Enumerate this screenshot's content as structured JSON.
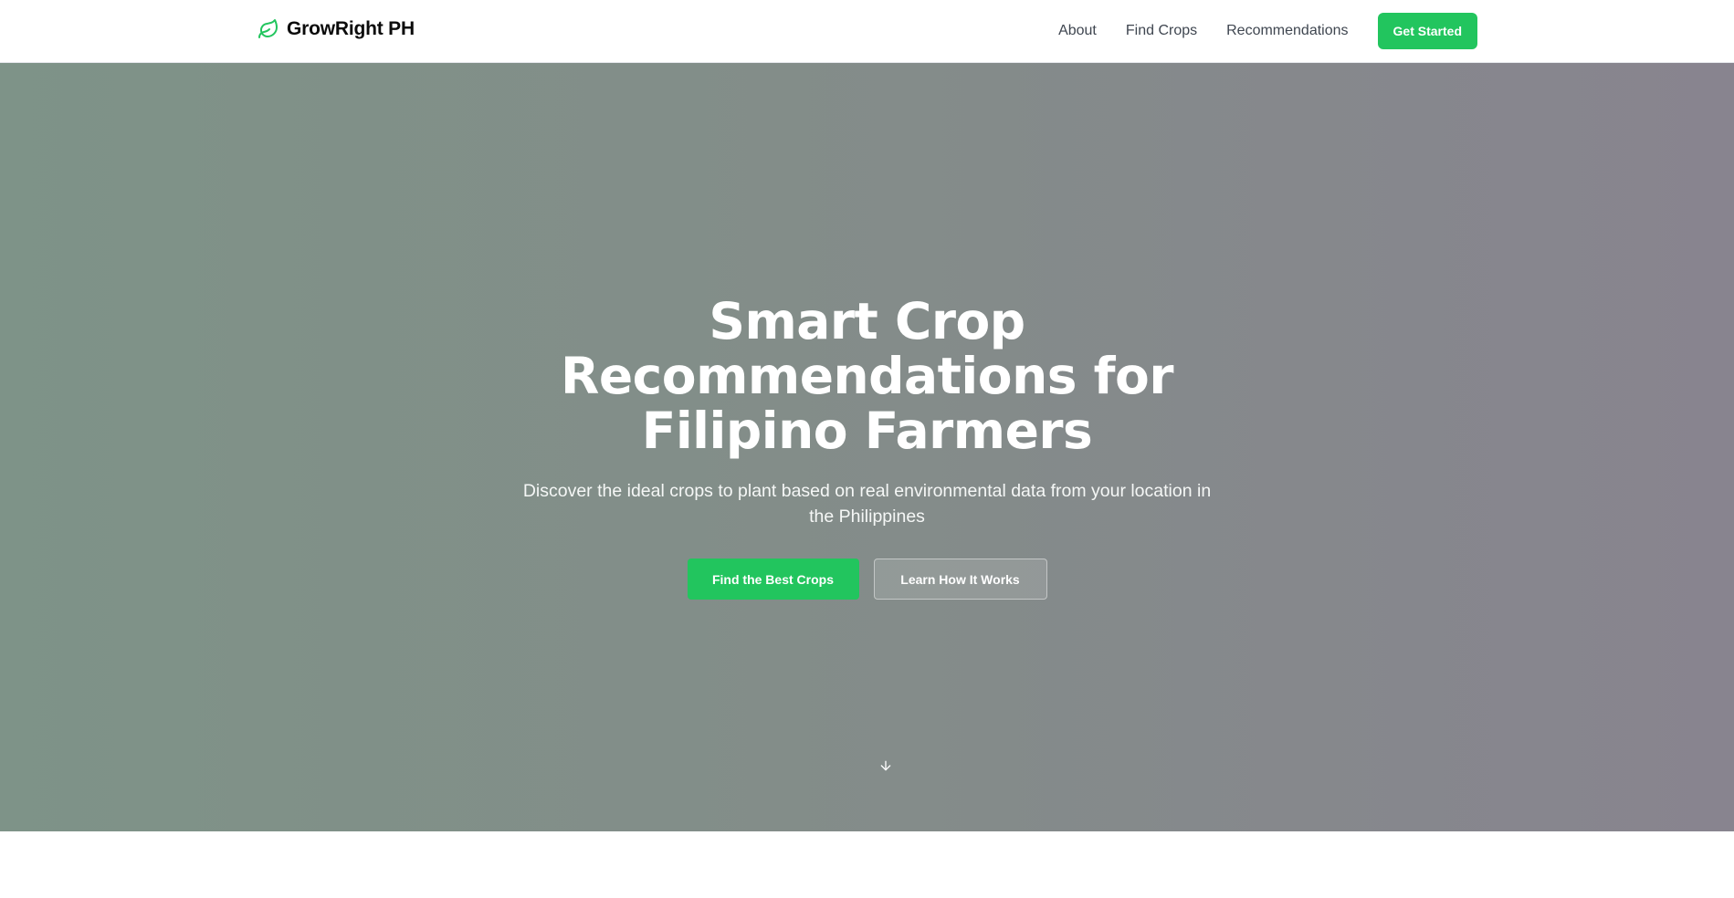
{
  "nav": {
    "brand_name": "GrowRight PH",
    "brand_icon": "leaf-icon",
    "links": [
      "About",
      "Find Crops",
      "Recommendations"
    ],
    "cta_label": "Get Started"
  },
  "hero": {
    "title": "Smart Crop Recommendations for Filipino Farmers",
    "subtitle": "Discover the ideal crops to plant based on real environmental data from your location in the Philippines",
    "primary_button": "Find the Best Crops",
    "secondary_button": "Learn How It Works",
    "scroll_icon": "arrow-down-icon"
  },
  "colors": {
    "accent": "#22c55e",
    "hero_gradient_start": "#7e9388",
    "hero_gradient_end": "#88848f"
  }
}
